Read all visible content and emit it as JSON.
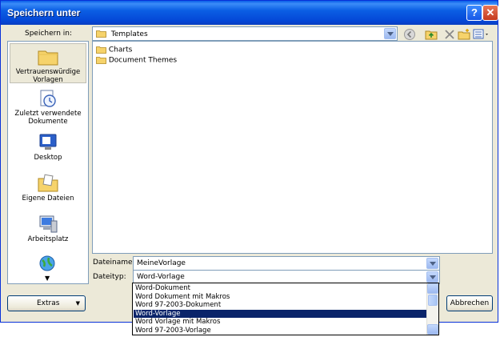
{
  "window": {
    "title": "Speichern unter",
    "help_glyph": "?",
    "close_glyph": "✕"
  },
  "location": {
    "label": "Speichern in:",
    "value": "Templates"
  },
  "places": [
    {
      "label": "Vertrauenswürdige Vorlagen",
      "icon": "folder-icon"
    },
    {
      "label": "Zuletzt verwendete Dokumente",
      "icon": "recent-documents-icon"
    },
    {
      "label": "Desktop",
      "icon": "desktop-icon"
    },
    {
      "label": "Eigene Dateien",
      "icon": "my-documents-icon"
    },
    {
      "label": "Arbeitsplatz",
      "icon": "my-computer-icon"
    }
  ],
  "files": [
    {
      "name": "Charts",
      "icon": "folder-icon"
    },
    {
      "name": "Document Themes",
      "icon": "folder-icon"
    }
  ],
  "filename": {
    "label": "Dateiname:",
    "value": "MeineVorlage"
  },
  "filetype": {
    "label": "Dateityp:",
    "value": "Word-Vorlage",
    "options": [
      "Word-Dokument",
      "Word Dokument mit Makros",
      "Word 97-2003-Dokument",
      "Word-Vorlage",
      "Word Vorlage mit Makros",
      "Word 97-2003-Vorlage"
    ],
    "selected_index": 3
  },
  "buttons": {
    "extras": "Extras",
    "cancel": "Abbrechen"
  },
  "colors": {
    "titlebar": "#0a5ee8",
    "selection": "#0a246a",
    "dialog_bg": "#ece9d8"
  }
}
